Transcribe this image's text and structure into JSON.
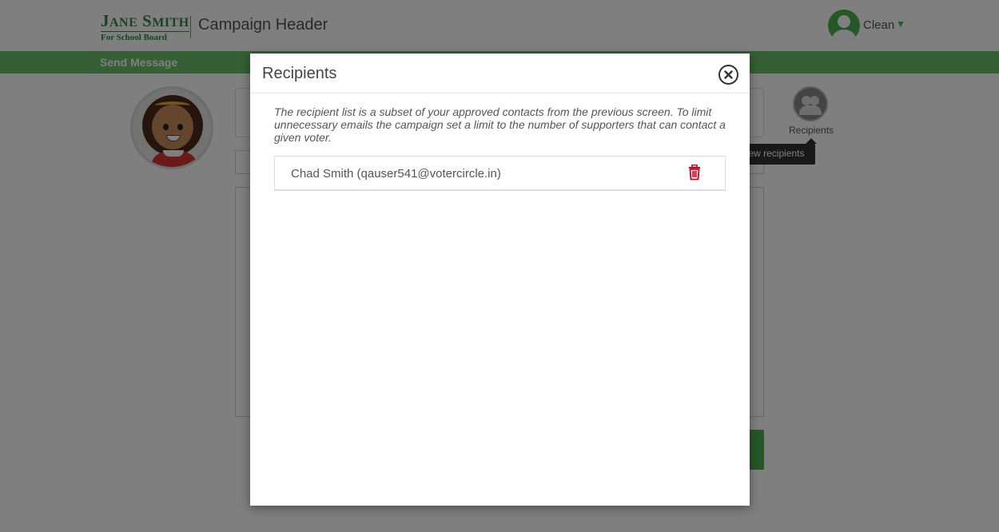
{
  "header": {
    "logo_name_first": "J",
    "logo_name_first_small": "ANE",
    "logo_name_last": "S",
    "logo_name_last_small": "MITH",
    "logo_subtitle": "For School Board",
    "campaign_title": "Campaign Header",
    "user_name": "Clean",
    "user_caret": "▼"
  },
  "nav": {
    "send_message_label": "Send Message"
  },
  "sidebar": {
    "recipients_label": "Recipients",
    "tooltip": "View recipients"
  },
  "modal": {
    "title": "Recipients",
    "note": "The recipient list is a subset of your approved contacts from the previous screen. To limit unnecessary emails the campaign set a limit to the number of supporters that can contact a given voter.",
    "recipients": [
      {
        "display": "Chad Smith (qauser541@votercircle.in)"
      }
    ]
  },
  "colors": {
    "brand_green": "#4caf50",
    "logo_green": "#2f8a3e",
    "delete_red": "#d0021b"
  },
  "icons": {
    "close": "close-circle-icon",
    "delete": "trash-icon",
    "recipients": "group-icon",
    "user": "user-avatar-icon"
  }
}
